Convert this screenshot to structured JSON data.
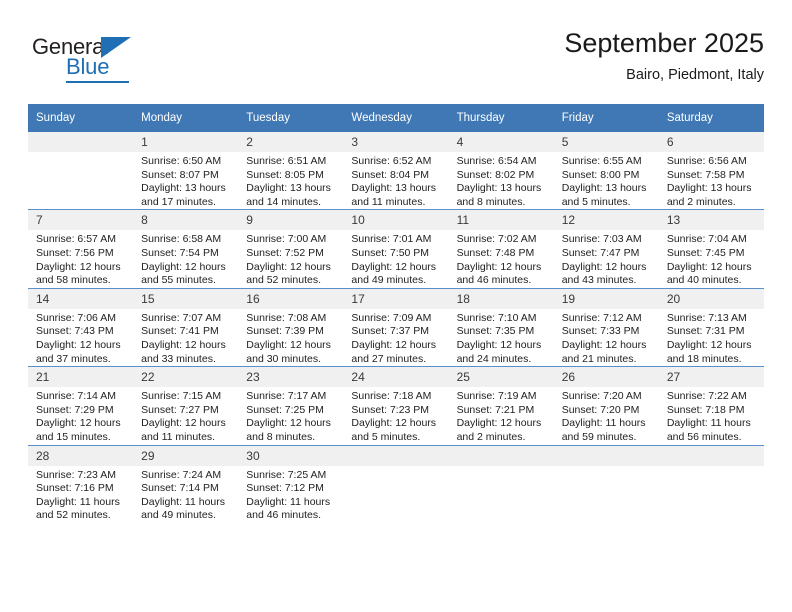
{
  "brand": {
    "name_part1": "General",
    "name_part2": "Blue"
  },
  "header": {
    "title": "September 2025",
    "location": "Bairo, Piedmont, Italy"
  },
  "weekdays": [
    "Sunday",
    "Monday",
    "Tuesday",
    "Wednesday",
    "Thursday",
    "Friday",
    "Saturday"
  ],
  "colors": {
    "header_blue": "#3f78b5",
    "grid_line": "#5b8fc9",
    "daynum_band": "#f0f0f0",
    "logo_blue": "#1f6fb5"
  },
  "weeks": [
    [
      {
        "day": "",
        "sunrise": "",
        "sunset": "",
        "daylight1": "",
        "daylight2": ""
      },
      {
        "day": "1",
        "sunrise": "Sunrise: 6:50 AM",
        "sunset": "Sunset: 8:07 PM",
        "daylight1": "Daylight: 13 hours",
        "daylight2": "and 17 minutes."
      },
      {
        "day": "2",
        "sunrise": "Sunrise: 6:51 AM",
        "sunset": "Sunset: 8:05 PM",
        "daylight1": "Daylight: 13 hours",
        "daylight2": "and 14 minutes."
      },
      {
        "day": "3",
        "sunrise": "Sunrise: 6:52 AM",
        "sunset": "Sunset: 8:04 PM",
        "daylight1": "Daylight: 13 hours",
        "daylight2": "and 11 minutes."
      },
      {
        "day": "4",
        "sunrise": "Sunrise: 6:54 AM",
        "sunset": "Sunset: 8:02 PM",
        "daylight1": "Daylight: 13 hours",
        "daylight2": "and 8 minutes."
      },
      {
        "day": "5",
        "sunrise": "Sunrise: 6:55 AM",
        "sunset": "Sunset: 8:00 PM",
        "daylight1": "Daylight: 13 hours",
        "daylight2": "and 5 minutes."
      },
      {
        "day": "6",
        "sunrise": "Sunrise: 6:56 AM",
        "sunset": "Sunset: 7:58 PM",
        "daylight1": "Daylight: 13 hours",
        "daylight2": "and 2 minutes."
      }
    ],
    [
      {
        "day": "7",
        "sunrise": "Sunrise: 6:57 AM",
        "sunset": "Sunset: 7:56 PM",
        "daylight1": "Daylight: 12 hours",
        "daylight2": "and 58 minutes."
      },
      {
        "day": "8",
        "sunrise": "Sunrise: 6:58 AM",
        "sunset": "Sunset: 7:54 PM",
        "daylight1": "Daylight: 12 hours",
        "daylight2": "and 55 minutes."
      },
      {
        "day": "9",
        "sunrise": "Sunrise: 7:00 AM",
        "sunset": "Sunset: 7:52 PM",
        "daylight1": "Daylight: 12 hours",
        "daylight2": "and 52 minutes."
      },
      {
        "day": "10",
        "sunrise": "Sunrise: 7:01 AM",
        "sunset": "Sunset: 7:50 PM",
        "daylight1": "Daylight: 12 hours",
        "daylight2": "and 49 minutes."
      },
      {
        "day": "11",
        "sunrise": "Sunrise: 7:02 AM",
        "sunset": "Sunset: 7:48 PM",
        "daylight1": "Daylight: 12 hours",
        "daylight2": "and 46 minutes."
      },
      {
        "day": "12",
        "sunrise": "Sunrise: 7:03 AM",
        "sunset": "Sunset: 7:47 PM",
        "daylight1": "Daylight: 12 hours",
        "daylight2": "and 43 minutes."
      },
      {
        "day": "13",
        "sunrise": "Sunrise: 7:04 AM",
        "sunset": "Sunset: 7:45 PM",
        "daylight1": "Daylight: 12 hours",
        "daylight2": "and 40 minutes."
      }
    ],
    [
      {
        "day": "14",
        "sunrise": "Sunrise: 7:06 AM",
        "sunset": "Sunset: 7:43 PM",
        "daylight1": "Daylight: 12 hours",
        "daylight2": "and 37 minutes."
      },
      {
        "day": "15",
        "sunrise": "Sunrise: 7:07 AM",
        "sunset": "Sunset: 7:41 PM",
        "daylight1": "Daylight: 12 hours",
        "daylight2": "and 33 minutes."
      },
      {
        "day": "16",
        "sunrise": "Sunrise: 7:08 AM",
        "sunset": "Sunset: 7:39 PM",
        "daylight1": "Daylight: 12 hours",
        "daylight2": "and 30 minutes."
      },
      {
        "day": "17",
        "sunrise": "Sunrise: 7:09 AM",
        "sunset": "Sunset: 7:37 PM",
        "daylight1": "Daylight: 12 hours",
        "daylight2": "and 27 minutes."
      },
      {
        "day": "18",
        "sunrise": "Sunrise: 7:10 AM",
        "sunset": "Sunset: 7:35 PM",
        "daylight1": "Daylight: 12 hours",
        "daylight2": "and 24 minutes."
      },
      {
        "day": "19",
        "sunrise": "Sunrise: 7:12 AM",
        "sunset": "Sunset: 7:33 PM",
        "daylight1": "Daylight: 12 hours",
        "daylight2": "and 21 minutes."
      },
      {
        "day": "20",
        "sunrise": "Sunrise: 7:13 AM",
        "sunset": "Sunset: 7:31 PM",
        "daylight1": "Daylight: 12 hours",
        "daylight2": "and 18 minutes."
      }
    ],
    [
      {
        "day": "21",
        "sunrise": "Sunrise: 7:14 AM",
        "sunset": "Sunset: 7:29 PM",
        "daylight1": "Daylight: 12 hours",
        "daylight2": "and 15 minutes."
      },
      {
        "day": "22",
        "sunrise": "Sunrise: 7:15 AM",
        "sunset": "Sunset: 7:27 PM",
        "daylight1": "Daylight: 12 hours",
        "daylight2": "and 11 minutes."
      },
      {
        "day": "23",
        "sunrise": "Sunrise: 7:17 AM",
        "sunset": "Sunset: 7:25 PM",
        "daylight1": "Daylight: 12 hours",
        "daylight2": "and 8 minutes."
      },
      {
        "day": "24",
        "sunrise": "Sunrise: 7:18 AM",
        "sunset": "Sunset: 7:23 PM",
        "daylight1": "Daylight: 12 hours",
        "daylight2": "and 5 minutes."
      },
      {
        "day": "25",
        "sunrise": "Sunrise: 7:19 AM",
        "sunset": "Sunset: 7:21 PM",
        "daylight1": "Daylight: 12 hours",
        "daylight2": "and 2 minutes."
      },
      {
        "day": "26",
        "sunrise": "Sunrise: 7:20 AM",
        "sunset": "Sunset: 7:20 PM",
        "daylight1": "Daylight: 11 hours",
        "daylight2": "and 59 minutes."
      },
      {
        "day": "27",
        "sunrise": "Sunrise: 7:22 AM",
        "sunset": "Sunset: 7:18 PM",
        "daylight1": "Daylight: 11 hours",
        "daylight2": "and 56 minutes."
      }
    ],
    [
      {
        "day": "28",
        "sunrise": "Sunrise: 7:23 AM",
        "sunset": "Sunset: 7:16 PM",
        "daylight1": "Daylight: 11 hours",
        "daylight2": "and 52 minutes."
      },
      {
        "day": "29",
        "sunrise": "Sunrise: 7:24 AM",
        "sunset": "Sunset: 7:14 PM",
        "daylight1": "Daylight: 11 hours",
        "daylight2": "and 49 minutes."
      },
      {
        "day": "30",
        "sunrise": "Sunrise: 7:25 AM",
        "sunset": "Sunset: 7:12 PM",
        "daylight1": "Daylight: 11 hours",
        "daylight2": "and 46 minutes."
      },
      {
        "day": "",
        "sunrise": "",
        "sunset": "",
        "daylight1": "",
        "daylight2": ""
      },
      {
        "day": "",
        "sunrise": "",
        "sunset": "",
        "daylight1": "",
        "daylight2": ""
      },
      {
        "day": "",
        "sunrise": "",
        "sunset": "",
        "daylight1": "",
        "daylight2": ""
      },
      {
        "day": "",
        "sunrise": "",
        "sunset": "",
        "daylight1": "",
        "daylight2": ""
      }
    ]
  ]
}
